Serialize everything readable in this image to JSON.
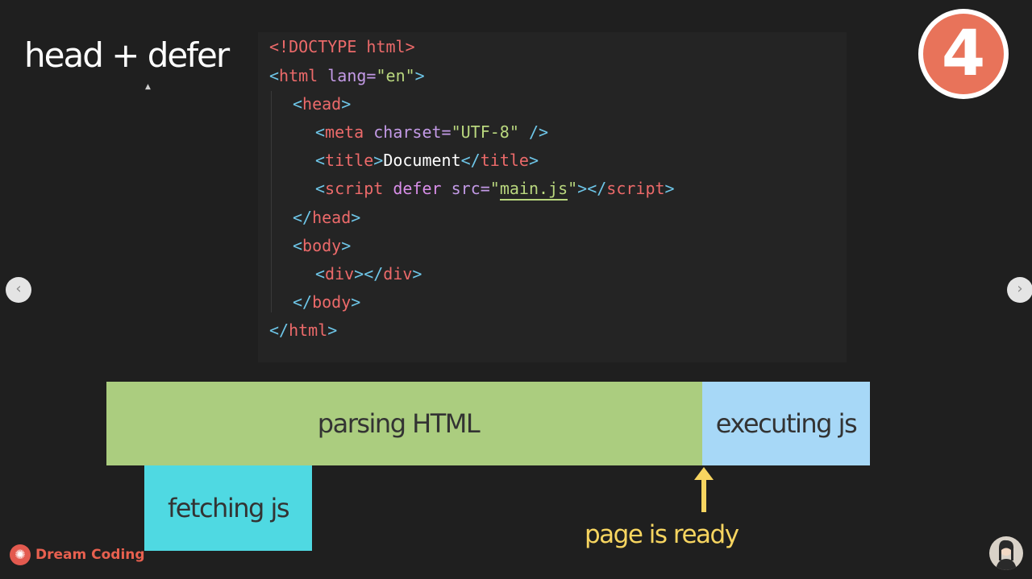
{
  "slide": {
    "title": "head + defer",
    "step_number": "4"
  },
  "code": {
    "doctype": "<!DOCTYPE html>",
    "html_open_tag": "html",
    "html_attr": "lang=",
    "html_attr_value": "\"en\"",
    "head_open": "head",
    "meta_tag": "meta",
    "meta_attr": "charset=",
    "meta_value": "\"UTF-8\"",
    "title_tag": "title",
    "title_text": "Document",
    "script_tag": "script",
    "script_defer": "defer",
    "script_src_attr": "src=",
    "script_src_value": "main.js",
    "body_open": "body",
    "div_tag": "div",
    "html_close": "html"
  },
  "timeline": {
    "parsing_label": "parsing HTML",
    "executing_label": "executing js",
    "fetching_label": "fetching js",
    "ready_label": "page is ready"
  },
  "brand": {
    "name": "Dream Coding"
  },
  "colors": {
    "parsing": "#abcd7f",
    "executing": "#a7d8f7",
    "fetching": "#4fd9e2",
    "ready": "#f7d560",
    "badge": "#e8735a"
  },
  "nav": {
    "prev_icon": "chevron-left-icon",
    "next_icon": "chevron-right-icon"
  }
}
